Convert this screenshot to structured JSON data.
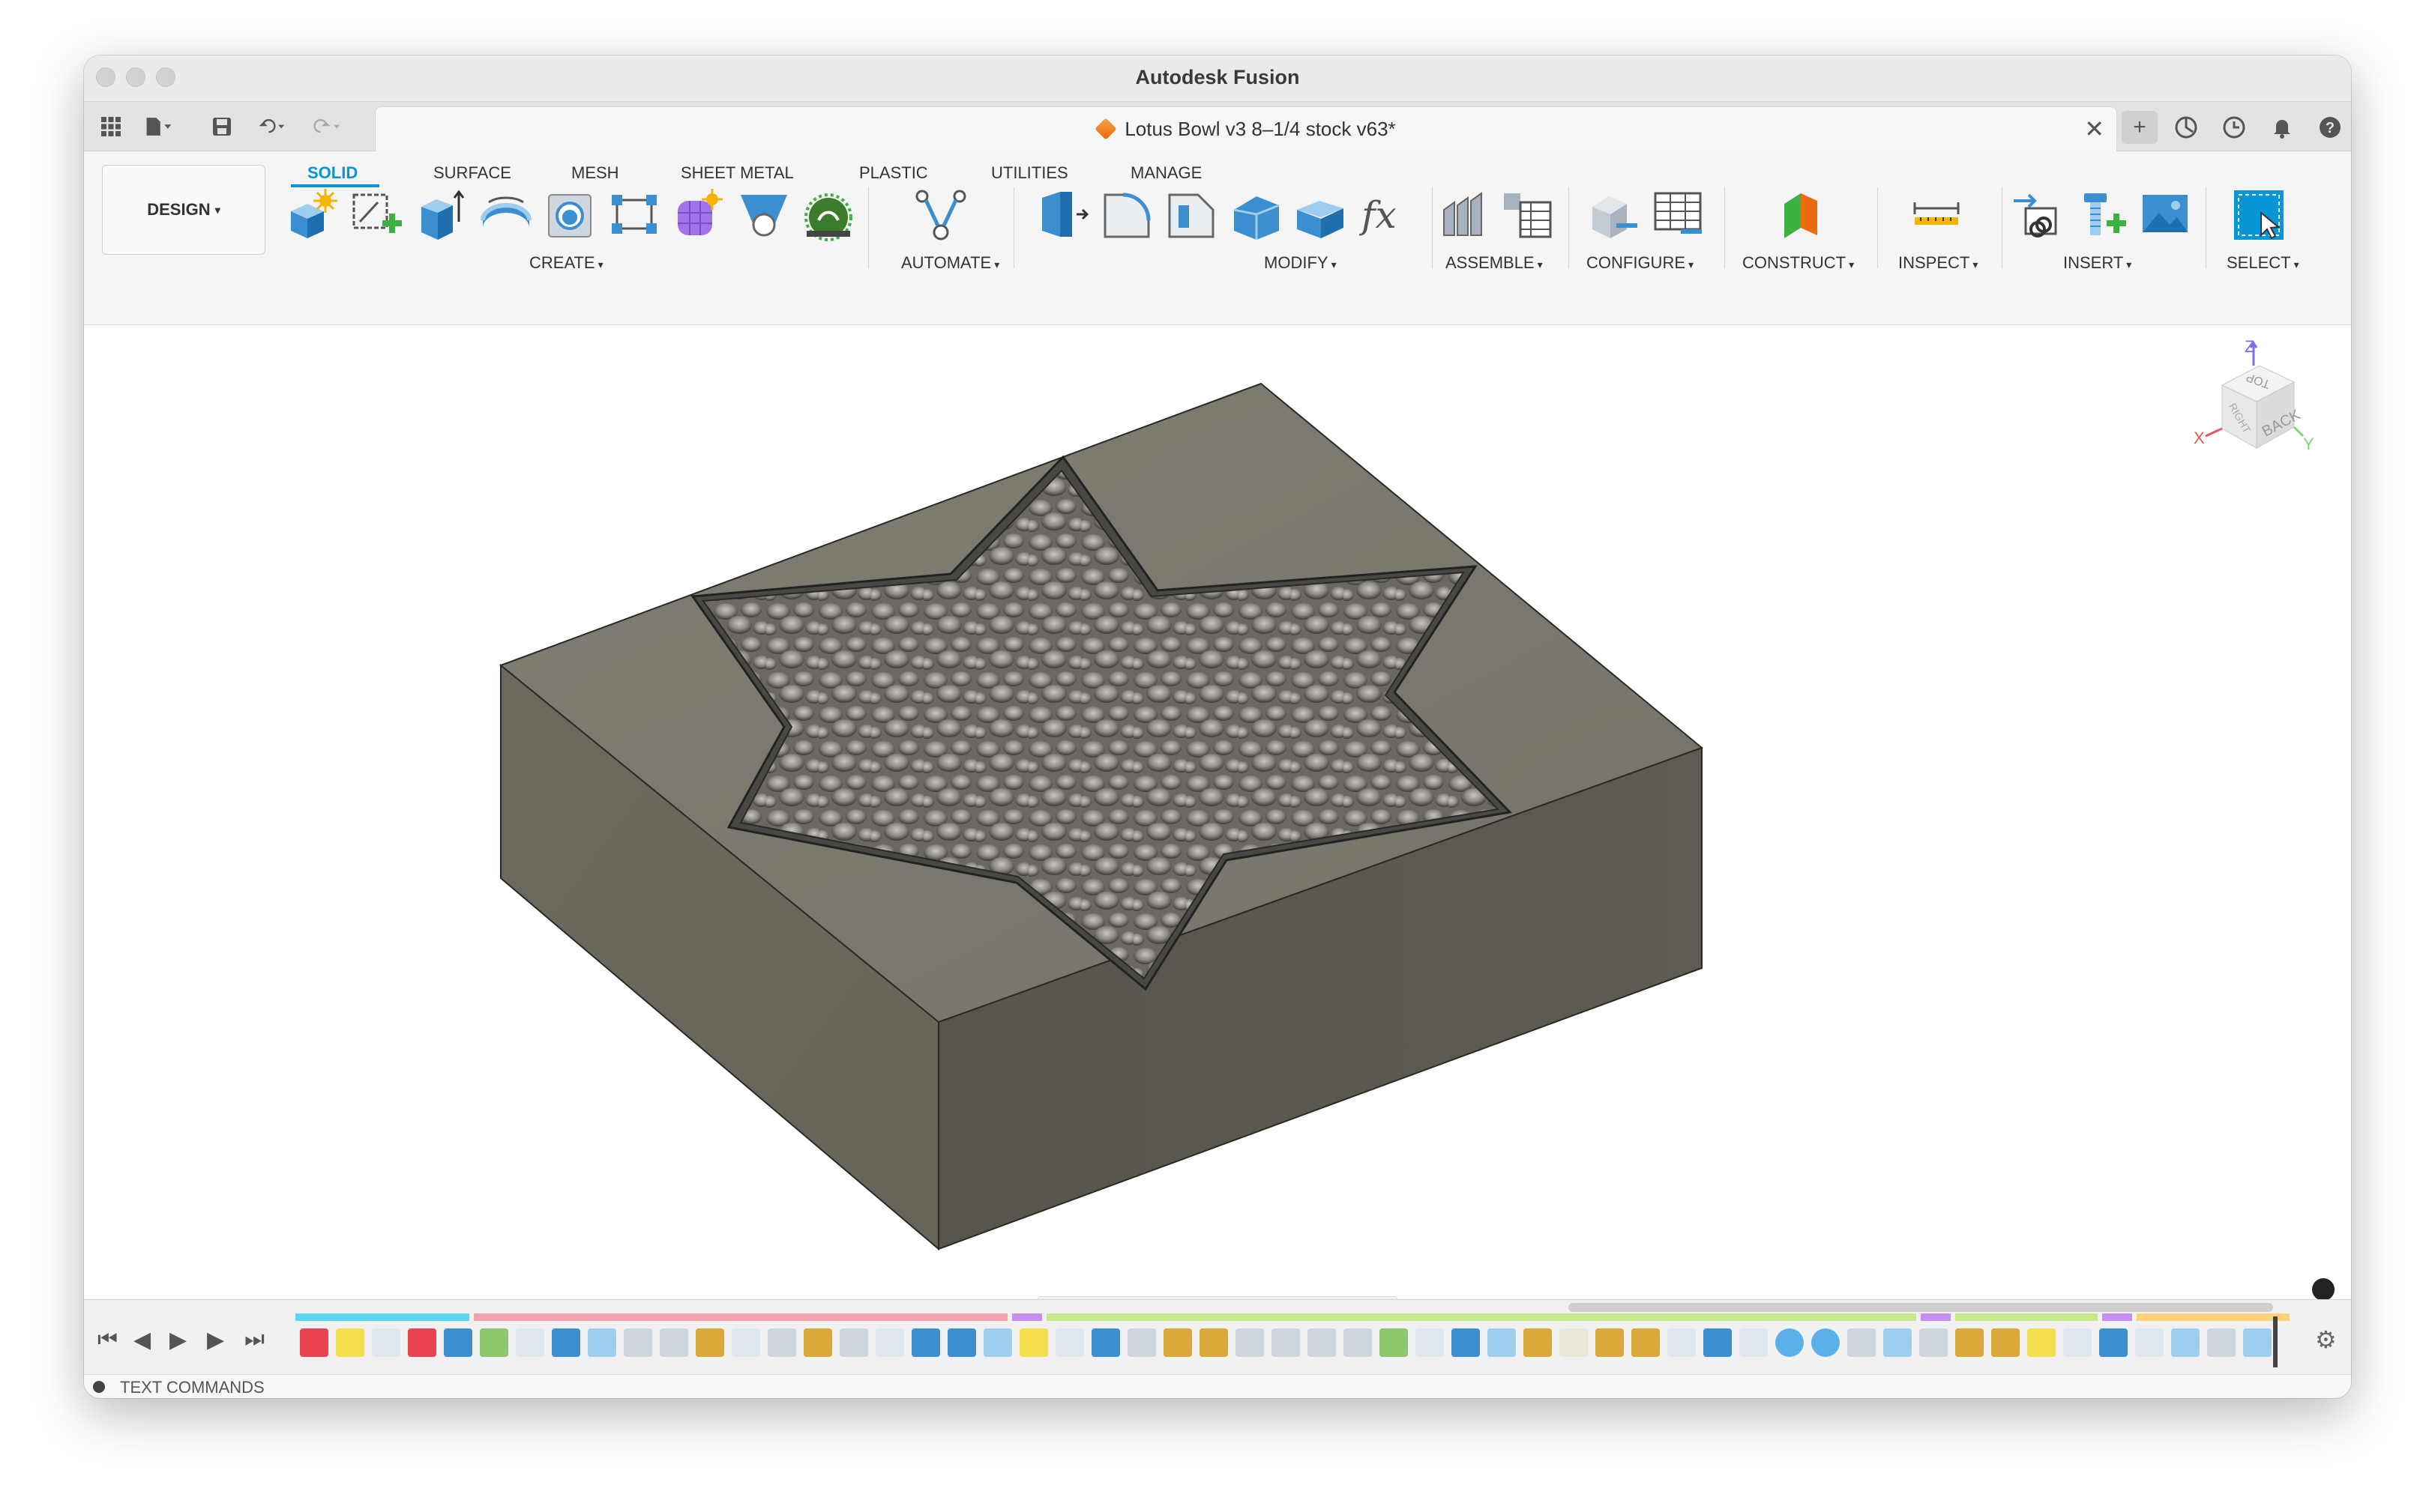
{
  "window": {
    "title": "Autodesk Fusion"
  },
  "document": {
    "title": "Lotus Bowl v3 8–1/4 stock v63*",
    "close_icon": "close-icon"
  },
  "workspace": {
    "label": "DESIGN",
    "caret": "▾"
  },
  "tabs": [
    {
      "label": "SOLID",
      "active": true
    },
    {
      "label": "SURFACE"
    },
    {
      "label": "MESH"
    },
    {
      "label": "SHEET METAL"
    },
    {
      "label": "PLASTIC"
    },
    {
      "label": "UTILITIES"
    },
    {
      "label": "MANAGE"
    }
  ],
  "groups": [
    {
      "label": "CREATE"
    },
    {
      "label": "AUTOMATE"
    },
    {
      "label": "MODIFY"
    },
    {
      "label": "ASSEMBLE"
    },
    {
      "label": "CONFIGURE"
    },
    {
      "label": "CONSTRUCT"
    },
    {
      "label": "INSPECT"
    },
    {
      "label": "INSERT"
    },
    {
      "label": "SELECT"
    }
  ],
  "viewcube": {
    "top": "TOP",
    "right": "RIGHT",
    "back": "BACK",
    "z": "Z",
    "x": "X",
    "y": "Y"
  },
  "text_commands": {
    "label": "TEXT COMMANDS"
  },
  "colors": {
    "accent": "#0696d7",
    "model_top": "#7b786e",
    "model_left": "#6a675e",
    "model_right": "#5d5a52",
    "model_rim": "#2a2926"
  }
}
